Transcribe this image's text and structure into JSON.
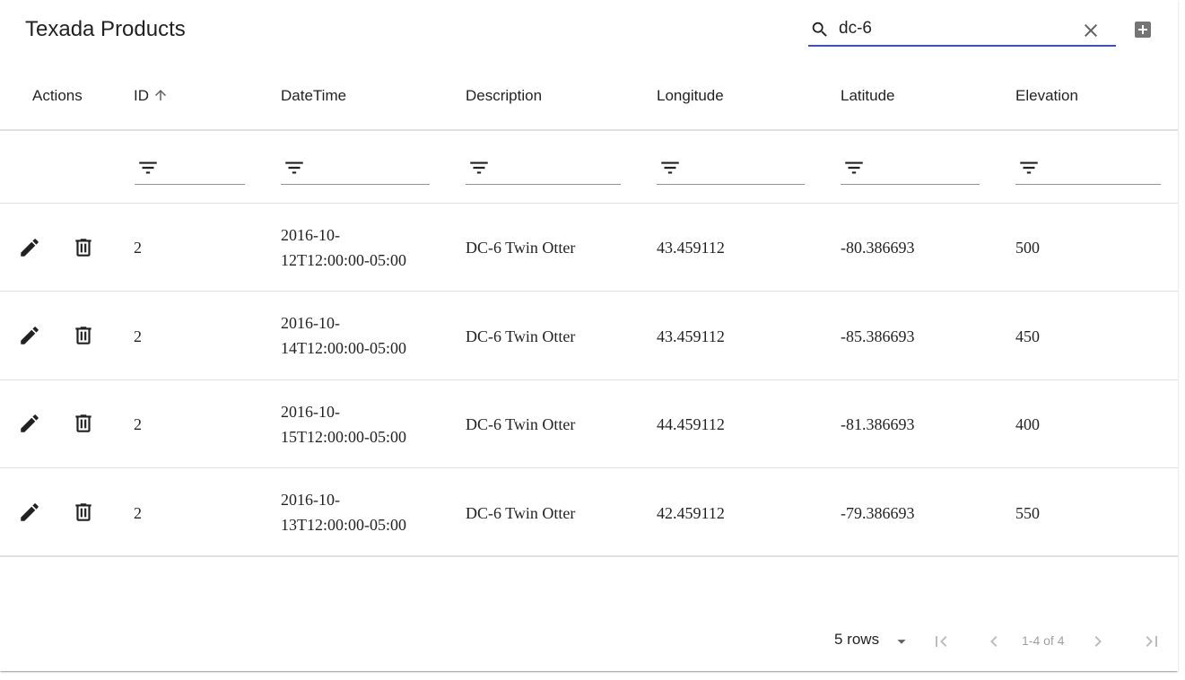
{
  "header": {
    "title": "Texada Products",
    "search_value": "dc-6"
  },
  "columns": [
    {
      "label": "Actions"
    },
    {
      "label": "ID"
    },
    {
      "label": "DateTime"
    },
    {
      "label": "Description"
    },
    {
      "label": "Longitude"
    },
    {
      "label": "Latitude"
    },
    {
      "label": "Elevation"
    }
  ],
  "rows": [
    {
      "id": "2",
      "datetime_line1": "2016-10-",
      "datetime_line2": "12T12:00:00-05:00",
      "description": "DC-6 Twin Otter",
      "longitude": "43.459112",
      "latitude": "-80.386693",
      "elevation": "500"
    },
    {
      "id": "2",
      "datetime_line1": "2016-10-",
      "datetime_line2": "14T12:00:00-05:00",
      "description": "DC-6 Twin Otter",
      "longitude": "43.459112",
      "latitude": "-85.386693",
      "elevation": "450"
    },
    {
      "id": "2",
      "datetime_line1": "2016-10-",
      "datetime_line2": "15T12:00:00-05:00",
      "description": "DC-6 Twin Otter",
      "longitude": "44.459112",
      "latitude": "-81.386693",
      "elevation": "400"
    },
    {
      "id": "2",
      "datetime_line1": "2016-10-",
      "datetime_line2": "13T12:00:00-05:00",
      "description": "DC-6 Twin Otter",
      "longitude": "42.459112",
      "latitude": "-79.386693",
      "elevation": "550"
    }
  ],
  "pagination": {
    "rows_per_page": "5 rows",
    "range_text": "1-4 of 4"
  },
  "icons": {
    "search": "search-icon",
    "clear": "close-icon",
    "add": "add-box-icon",
    "sort": "arrow-upward-icon",
    "filter": "filter-list-icon",
    "edit": "edit-icon",
    "delete": "delete-icon",
    "first": "first-page-icon",
    "prev": "chevron-left-icon",
    "next": "chevron-right-icon",
    "last": "last-page-icon",
    "dropdown": "arrow-drop-down-icon"
  },
  "colors": {
    "accent": "#3f51b5",
    "icon": "#212121",
    "disabled": "#bdbdbd"
  }
}
